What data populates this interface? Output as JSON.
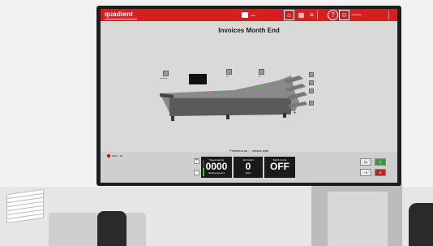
{
  "topbar": {
    "logo": "quadient",
    "user_text": "user",
    "buttons": [
      {
        "name": "home",
        "glyph": "⌂"
      },
      {
        "name": "grid",
        "glyph": "▦"
      },
      {
        "name": "list",
        "glyph": "≡"
      },
      {
        "name": "help",
        "glyph": "?"
      },
      {
        "name": "account",
        "glyph": "☺"
      }
    ],
    "account_label": "Operator"
  },
  "page_title": "Invoices Month End",
  "stations": [
    {
      "label": "Envelopes"
    },
    {
      "label": "B1"
    },
    {
      "label": "B2"
    }
  ],
  "status_text": "Powering up ... please wait",
  "bottom": {
    "job_name": "DMS - 1R",
    "speed": {
      "label": "Speed setting",
      "value": "0000",
      "sub": "Machine Speed 3",
      "level": 0.5
    },
    "job_count": {
      "label": "Job Count",
      "value": "0",
      "sub": "Total 0"
    },
    "batch_count": {
      "label": "Batch Count",
      "value": "OFF"
    },
    "buttons": {
      "single": "1x",
      "mode": "⇥",
      "start": "◇",
      "stop": "⊘"
    }
  },
  "colors": {
    "brand_red": "#d61f1f",
    "start_green": "#3a9a3a",
    "stop_red": "#c02020"
  }
}
